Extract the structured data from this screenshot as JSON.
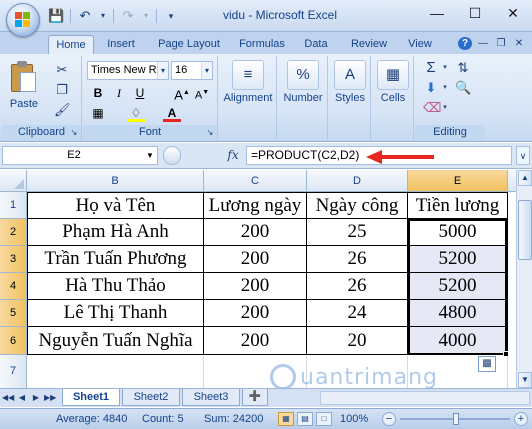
{
  "window": {
    "title": "vidu - Microsoft Excel",
    "controls": [
      "minimize-icon",
      "maximize-icon",
      "close-icon"
    ]
  },
  "quick_access": [
    "save-icon",
    "undo-icon",
    "redo-icon",
    "customize-icon"
  ],
  "ribbon": {
    "tabs": [
      "Home",
      "Insert",
      "Page Layout",
      "Formulas",
      "Data",
      "Review",
      "View"
    ],
    "active_tab": "Home",
    "clipboard": {
      "paste_label": "Paste",
      "group_label": "Clipboard"
    },
    "font": {
      "name": "Times New Ro",
      "size": "16",
      "group_label": "Font"
    },
    "alignment_label": "Alignment",
    "number_label": "Number",
    "styles_label": "Styles",
    "cells_label": "Cells",
    "editing": {
      "group_label": "Editing"
    }
  },
  "formula_bar": {
    "name_box": "E2",
    "fx": "fx",
    "formula": "=PRODUCT(C2,D2)"
  },
  "sheet": {
    "columns": [
      "B",
      "C",
      "D",
      "E"
    ],
    "selected_column": "E",
    "rows": [
      "1",
      "2",
      "3",
      "4",
      "5",
      "6",
      "7"
    ],
    "headers": [
      "Họ và Tên",
      "Lương ngày",
      "Ngày công",
      "Tiền lương"
    ],
    "data": [
      [
        "Phạm Hà Anh",
        "200",
        "25",
        "5000"
      ],
      [
        "Trần Tuấn Phương",
        "200",
        "26",
        "5200"
      ],
      [
        "Hà Thu Thảo",
        "200",
        "26",
        "5200"
      ],
      [
        "Lê Thị Thanh",
        "200",
        "24",
        "4800"
      ],
      [
        "Nguyễn Tuấn Nghĩa",
        "200",
        "20",
        "4000"
      ]
    ]
  },
  "sheet_tabs": [
    "Sheet1",
    "Sheet2",
    "Sheet3"
  ],
  "active_sheet": "Sheet1",
  "status": {
    "average": "Average: 4840",
    "count": "Count: 5",
    "sum": "Sum: 24200",
    "zoom": "100%"
  },
  "watermark": "uantrimang",
  "colors": {
    "accent": "#15428b",
    "selection_header": "#f1c15f",
    "arrow": "#e8251f"
  }
}
